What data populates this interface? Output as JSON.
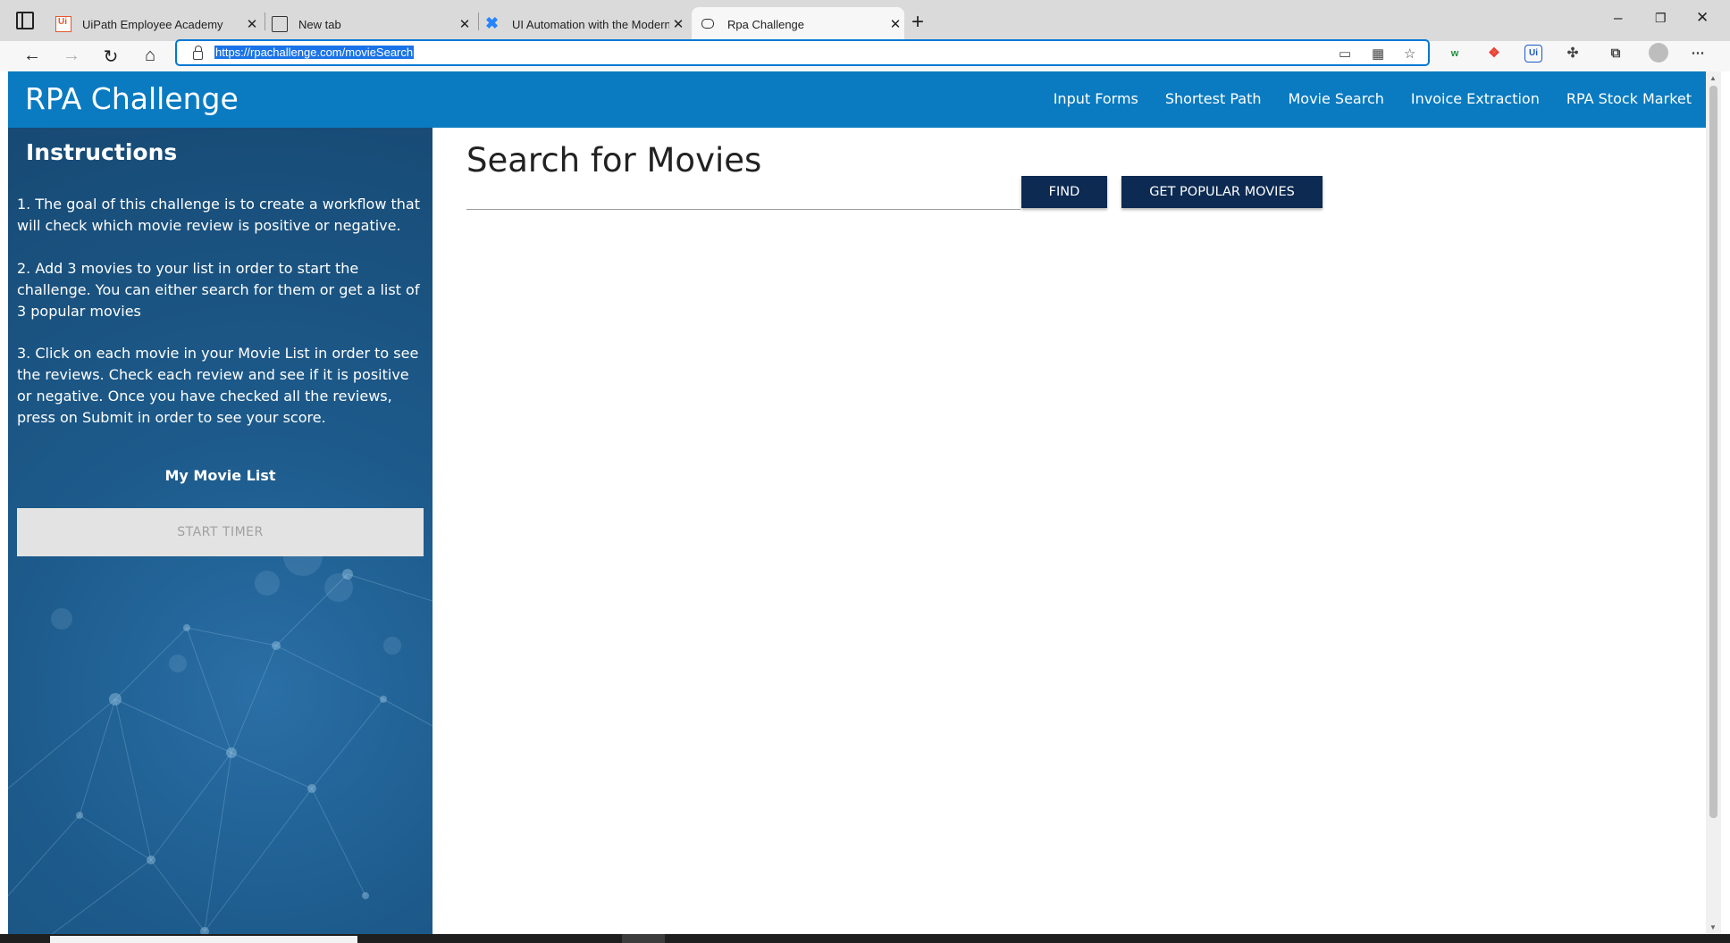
{
  "browser": {
    "tabs": [
      {
        "title": "UiPath Employee Academy",
        "icon": "uipath-orange-icon"
      },
      {
        "title": "New tab",
        "icon": "newtab-page-icon"
      },
      {
        "title": "UI Automation with the Modern",
        "icon": "confluence-icon"
      },
      {
        "title": "Rpa Challenge",
        "icon": "robot-icon"
      }
    ],
    "url": "https://rpachallenge.com/movieSearch"
  },
  "site": {
    "brand": "RPA Challenge",
    "nav": [
      "Input Forms",
      "Shortest Path",
      "Movie Search",
      "Invoice Extraction",
      "RPA Stock Market"
    ]
  },
  "sidebar": {
    "title": "Instructions",
    "steps": [
      "1. The goal of this challenge is to create a workflow that will check which movie review is positive or negative.",
      "2. Add 3 movies to your list in order to start the challenge. You can either search for them or get a list of 3 popular movies",
      "3. Click on each movie in your Movie List in order to see the reviews. Check each review and see if it is positive or negative. Once you have checked all the reviews, press on Submit in order to see your score."
    ],
    "list_title": "My Movie List",
    "start_button": "START TIMER"
  },
  "main": {
    "title": "Search for Movies",
    "search_value": "",
    "find_button": "FIND",
    "popular_button": "GET POPULAR MOVIES"
  },
  "colors": {
    "header": "#0a7bc1",
    "button": "#0c2a52",
    "sidebar": "#1d5b8c"
  }
}
